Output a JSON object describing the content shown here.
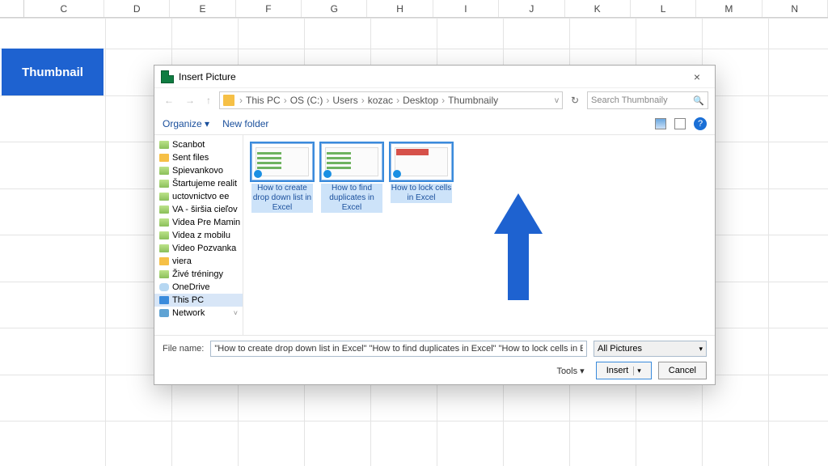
{
  "excel": {
    "columns": [
      "C",
      "D",
      "E",
      "F",
      "G",
      "H",
      "I",
      "J",
      "K",
      "L",
      "M",
      "N"
    ],
    "cell_header": "Thumbnail"
  },
  "dialog": {
    "title": "Insert Picture",
    "close_label": "×",
    "breadcrumbs": [
      "This PC",
      "OS (C:)",
      "Users",
      "kozac",
      "Desktop",
      "Thumbnaily"
    ],
    "search_placeholder": "Search Thumbnaily",
    "refresh_label": "↻",
    "organize_label": "Organize ▾",
    "newfolder_label": "New folder",
    "help_label": "?",
    "tree": [
      {
        "label": "Scanbot",
        "type": "img"
      },
      {
        "label": "Sent files",
        "type": "folder"
      },
      {
        "label": "Spievankovo",
        "type": "img"
      },
      {
        "label": "Štartujeme realit",
        "type": "img"
      },
      {
        "label": "uctovnictvo ee",
        "type": "img"
      },
      {
        "label": "VA - širšia cieľov",
        "type": "img"
      },
      {
        "label": "Videa Pre Mamin",
        "type": "img"
      },
      {
        "label": "Videa z mobilu",
        "type": "img"
      },
      {
        "label": "Video Pozvanka",
        "type": "img"
      },
      {
        "label": "viera",
        "type": "folder"
      },
      {
        "label": "Živé tréningy",
        "type": "img"
      },
      {
        "label": "OneDrive",
        "type": "cloud"
      },
      {
        "label": "This PC",
        "type": "pc",
        "selected": true
      },
      {
        "label": "Network",
        "type": "net",
        "chev": true
      }
    ],
    "files": [
      {
        "name": "How to create drop down list in Excel",
        "selected": true,
        "style": "green"
      },
      {
        "name": "How to find duplicates in Excel",
        "selected": true,
        "style": "green"
      },
      {
        "name": "How to lock cells in Excel",
        "selected": true,
        "style": "red"
      }
    ],
    "filename_label": "File name:",
    "filename_value": "\"How to create drop down list in Excel\" \"How to find duplicates in Excel\" \"How to lock cells in Excel\"",
    "filter_label": "All Pictures",
    "tools_label": "Tools   ▾",
    "insert_label": "Insert",
    "cancel_label": "Cancel"
  }
}
